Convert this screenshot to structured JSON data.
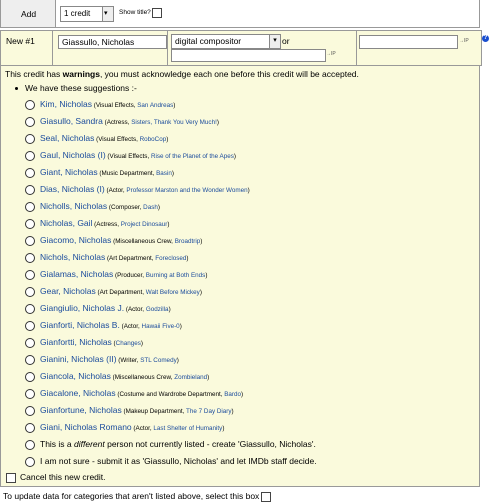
{
  "toprow": {
    "add_label": "Add",
    "credit_count": "1 credit",
    "show_title_label": "Show title?"
  },
  "newrow": {
    "label": "New #1",
    "name_value": "Giassullo, Nicholas",
    "role_value": "digital compositor",
    "or_label": "or",
    "arrow_label": "→IP"
  },
  "warning": {
    "pre": "This credit has ",
    "bold": "warnings",
    "post": ", you must acknowledge each one before this credit will be accepted.",
    "suggest_heading": "We have these suggestions :-"
  },
  "suggestions": [
    {
      "name": "Kim, Nicholas",
      "pre": " (Visual Effects, ",
      "title": "San Andreas",
      "post": ")"
    },
    {
      "name": "Giasullo, Sandra",
      "pre": " (Actress, ",
      "title": "Sisters, Thank You Very Much!",
      "post": ")"
    },
    {
      "name": "Seal, Nicholas",
      "pre": " (Visual Effects, ",
      "title": "RoboCop",
      "post": ")"
    },
    {
      "name": "Gaul, Nicholas (I)",
      "pre": " (Visual Effects, ",
      "title": "Rise of the Planet of the Apes",
      "post": ")"
    },
    {
      "name": "Giant, Nicholas",
      "pre": " (Music Department, ",
      "title": "Basin",
      "post": ")"
    },
    {
      "name": "Dias, Nicholas (I)",
      "pre": " (Actor, ",
      "title": "Professor Marston and the Wonder Women",
      "post": ")"
    },
    {
      "name": "Nicholls, Nicholas",
      "pre": " (Composer, ",
      "title": "Dash",
      "post": ")"
    },
    {
      "name": "Nicholas, Gail",
      "pre": " (Actress, ",
      "title": "Project Dinosaur",
      "post": ")"
    },
    {
      "name": "Giacomo, Nicholas",
      "pre": " (Miscellaneous Crew, ",
      "title": "Broadtrip",
      "post": ")"
    },
    {
      "name": "Nichols, Nicholas",
      "pre": " (Art Department, ",
      "title": "Foreclosed",
      "post": ")"
    },
    {
      "name": "Gialamas, Nicholas",
      "pre": " (Producer, ",
      "title": "Burning at Both Ends",
      "post": ")"
    },
    {
      "name": "Gear, Nicholas",
      "pre": " (Art Department, ",
      "title": "Walt Before Mickey",
      "post": ")"
    },
    {
      "name": "Giangiulio, Nicholas J.",
      "pre": " (Actor, ",
      "title": "Godzilla",
      "post": ")"
    },
    {
      "name": "Gianforti, Nicholas B.",
      "pre": " (Actor, ",
      "title": "Hawaii Five-0",
      "post": ")"
    },
    {
      "name": "Gianfortti, Nicholas",
      "pre": " (",
      "title": "Changes",
      "post": ")"
    },
    {
      "name": "Gianini, Nicholas (II)",
      "pre": " (Writer, ",
      "title": "STL Comedy",
      "post": ")"
    },
    {
      "name": "Giancola, Nicholas",
      "pre": " (Miscellaneous Crew, ",
      "title": "Zombieland",
      "post": ")"
    },
    {
      "name": "Giacalone, Nicholas",
      "pre": " (Costume and Wardrobe Department, ",
      "title": "Bardo",
      "post": ")"
    },
    {
      "name": "Gianfortune, Nicholas",
      "pre": " (Makeup Department, ",
      "title": "The 7 Day Diary",
      "post": ")"
    },
    {
      "name": "Giani, Nicholas Romano",
      "pre": " (Actor, ",
      "title": "Last Shelter of Humanity",
      "post": ")"
    }
  ],
  "other_options": {
    "different_pre": "This is a ",
    "different_em": "different",
    "different_post": " person not currently listed - create 'Giassullo, Nicholas'.",
    "not_sure": "I am not sure - submit it as 'Giassullo, Nicholas' and let IMDb staff decide."
  },
  "cancel_label": "Cancel this new credit.",
  "bottom_note": "To update data for categories that aren't listed above, select this box"
}
